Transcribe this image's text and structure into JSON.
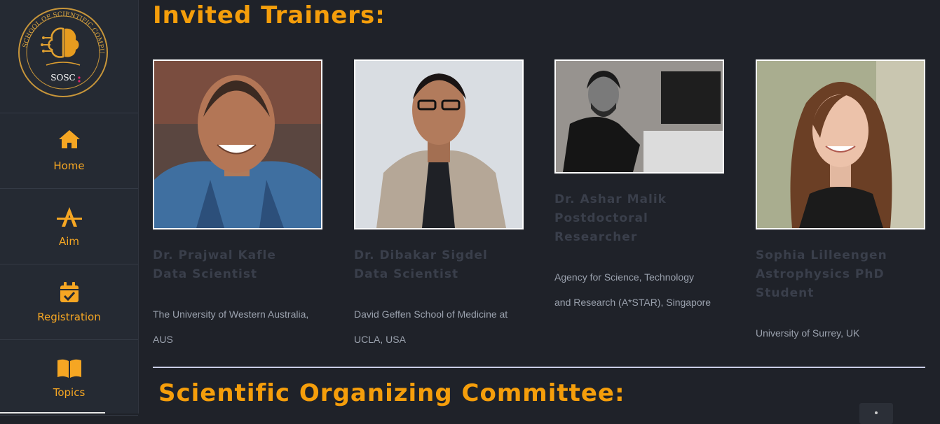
{
  "logo": {
    "arc_text": "SCHOOL OF SCIENTIFIC COMPUTING",
    "label": "SOSC"
  },
  "sidebar": {
    "items": [
      {
        "label": "Home",
        "icon": "home-icon"
      },
      {
        "label": "Aim",
        "icon": "aim-icon"
      },
      {
        "label": "Registration",
        "icon": "calendar-check-icon"
      },
      {
        "label": "Topics",
        "icon": "book-open-icon"
      }
    ]
  },
  "main": {
    "trainers_heading": "Invited Trainers:",
    "committee_heading": "Scientific Organizing Committee:",
    "trainers": [
      {
        "name": "Dr. Prajwal Kafle",
        "role": "Data Scientist",
        "affiliation_line1": "The University of Western Australia,",
        "affiliation_line2": "AUS"
      },
      {
        "name": "Dr. Dibakar Sigdel",
        "role": "Data Scientist",
        "affiliation_line1": "David Geffen School of Medicine at",
        "affiliation_line2": "UCLA, USA"
      },
      {
        "name": "Dr. Ashar Malik",
        "role_line1": "Postdoctoral",
        "role_line2": "Researcher",
        "affiliation_line1": "Agency for Science, Technology",
        "affiliation_line2": "and Research (A*STAR), Singapore"
      },
      {
        "name": "Sophia Lilleengen",
        "role_line1": "Astrophysics PhD",
        "role_line2": "Student",
        "affiliation_line1": "University of Surrey, UK"
      }
    ]
  },
  "colors": {
    "accent": "#f59e0b",
    "background": "#1f2229",
    "sidebar": "#252a33"
  }
}
